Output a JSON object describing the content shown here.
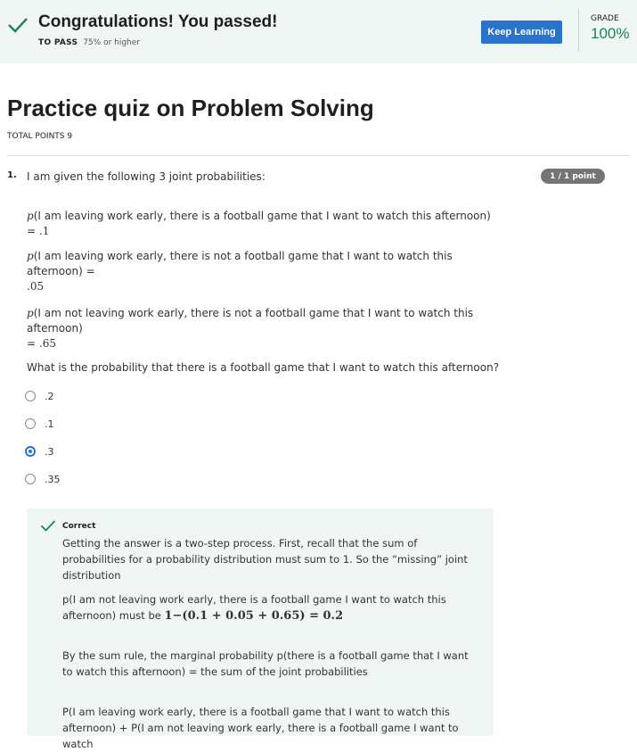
{
  "banner": {
    "title": "Congratulations! You passed!",
    "to_pass_label": "TO PASS",
    "to_pass_value": "75% or higher",
    "keep_learning_label": "Keep Learning",
    "grade_label": "GRADE",
    "grade_value": "100%"
  },
  "quiz": {
    "title": "Practice quiz on Problem Solving",
    "total_points": "TOTAL POINTS 9"
  },
  "question": {
    "number": "1.",
    "prompt": "I am given the following 3 joint probabilities:",
    "points": "1 / 1 point",
    "statements": [
      {
        "p": "p",
        "line1": "(I am leaving work early, there is a football game that I want to watch this afternoon) = ",
        "value1": ".1",
        "line2": "",
        "value2": ""
      },
      {
        "p": "p",
        "line1": "(I am leaving work early, there is not a football game that I want to watch this afternoon) =",
        "value1": "",
        "line2": "",
        "value2": ".05"
      },
      {
        "p": "p",
        "line1": "(I am not leaving work early, there is not a football game that I want to watch this afternoon)",
        "value1": "",
        "line2": "= ",
        "value2": ".65"
      }
    ],
    "ask": "What is the probability that there is a football game that I want to watch this afternoon?",
    "options": [
      {
        "label": ".2",
        "selected": false
      },
      {
        "label": ".1",
        "selected": false
      },
      {
        "label": ".3",
        "selected": true
      },
      {
        "label": ".35",
        "selected": false
      }
    ]
  },
  "feedback": {
    "status": "Correct",
    "para1": "Getting the answer is a two-step process. First, recall that the sum of probabilities for a probability distribution must sum to 1. So the “missing” joint distribution",
    "para2_line1": "p(I am not leaving work early, there is a football game I want to watch this",
    "para2_line2": "afternoon) must be ",
    "para2_math": "1−(0.1 + 0.05 + 0.65) = 0.2",
    "para3": "By the sum rule, the marginal probability p(there is a football game that I want to watch this afternoon) = the sum of the joint probabilities",
    "para4": "P(I am leaving work early, there is a football game that I want to watch this afternoon) + P(I am not leaving work early, there is a football game I want to watch"
  },
  "colors": {
    "banner_bg": "#f0f6f3",
    "accent_blue": "#2a73cc",
    "success_green": "#1f8354",
    "badge_gray": "#757575"
  },
  "icons": [
    "check-icon",
    "radio-icon"
  ]
}
